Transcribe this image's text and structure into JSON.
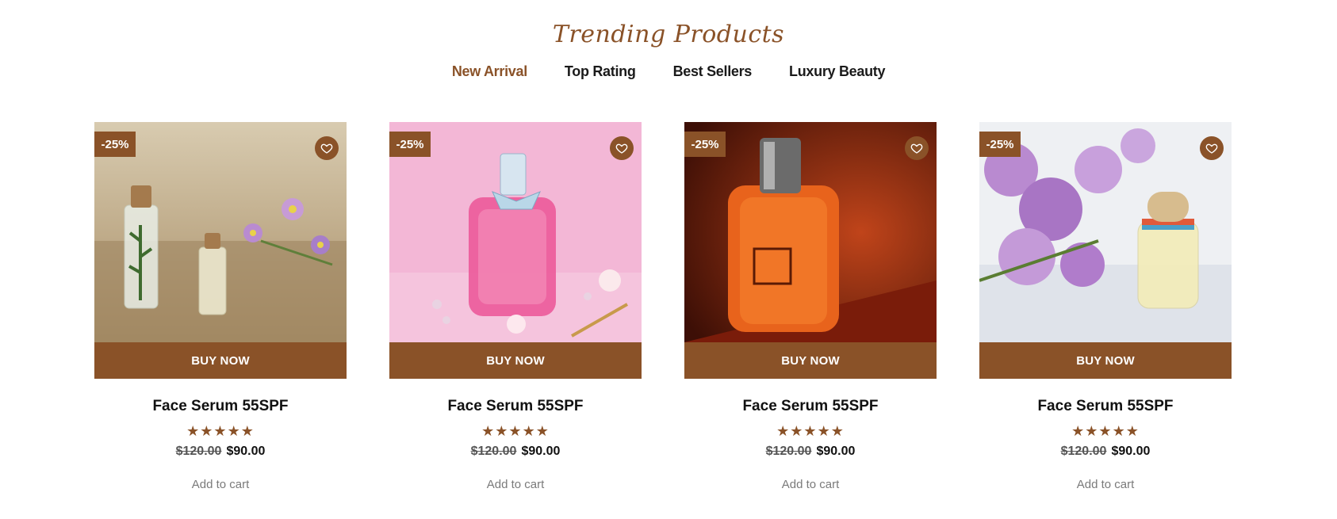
{
  "section": {
    "title": "Trending Products"
  },
  "tabs": [
    {
      "label": "New Arrival",
      "active": true
    },
    {
      "label": "Top Rating",
      "active": false
    },
    {
      "label": "Best Sellers",
      "active": false
    },
    {
      "label": "Luxury Beauty",
      "active": false
    }
  ],
  "products": [
    {
      "badge": "-25%",
      "buy_label": "BUY NOW",
      "name": "Face Serum 55SPF",
      "stars": "★★★★★",
      "rating": 5,
      "old_price": "$120.00",
      "price": "$90.00",
      "cart_label": "Add to cart",
      "icon": "heart-icon"
    },
    {
      "badge": "-25%",
      "buy_label": "BUY NOW",
      "name": "Face Serum 55SPF",
      "stars": "★★★★★",
      "rating": 5,
      "old_price": "$120.00",
      "price": "$90.00",
      "cart_label": "Add to cart",
      "icon": "heart-icon"
    },
    {
      "badge": "-25%",
      "buy_label": "BUY NOW",
      "name": "Face Serum 55SPF",
      "stars": "★★★★★",
      "rating": 5,
      "old_price": "$120.00",
      "price": "$90.00",
      "cart_label": "Add to cart",
      "icon": "heart-icon"
    },
    {
      "badge": "-25%",
      "buy_label": "BUY NOW",
      "name": "Face Serum 55SPF",
      "stars": "★★★★★",
      "rating": 5,
      "old_price": "$120.00",
      "price": "$90.00",
      "cart_label": "Add to cart",
      "icon": "heart-icon"
    }
  ],
  "colors": {
    "accent": "#8a5228",
    "text": "#111111",
    "muted": "#7a7a7a"
  }
}
